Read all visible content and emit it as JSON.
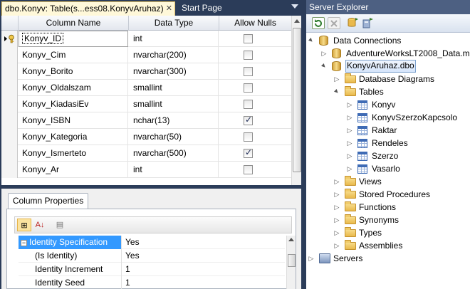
{
  "tabs": [
    {
      "label": "dbo.Konyv: Table(s...ess08.KonyvAruhaz)",
      "close": "✕"
    },
    {
      "label": "Start Page"
    }
  ],
  "grid": {
    "headers": [
      "Column Name",
      "Data Type",
      "Allow Nulls"
    ],
    "rows": [
      {
        "name": "Konyv_ID",
        "type": "int",
        "null": false,
        "key": true
      },
      {
        "name": "Konyv_Cim",
        "type": "nvarchar(200)",
        "null": false
      },
      {
        "name": "Konyv_Borito",
        "type": "nvarchar(300)",
        "null": false
      },
      {
        "name": "Konyv_Oldalszam",
        "type": "smallint",
        "null": false
      },
      {
        "name": "Konyv_KiadasiEv",
        "type": "smallint",
        "null": false
      },
      {
        "name": "Konyv_ISBN",
        "type": "nchar(13)",
        "null": true
      },
      {
        "name": "Konyv_Kategoria",
        "type": "nvarchar(50)",
        "null": false
      },
      {
        "name": "Konyv_Ismerteto",
        "type": "nvarchar(500)",
        "null": true
      },
      {
        "name": "Konyv_Ar",
        "type": "int",
        "null": false
      }
    ]
  },
  "column_properties": {
    "tab_label": "Column Properties",
    "toolbar": {
      "categorized": "⊞",
      "alphabetical": "A↓",
      "pages": "▤"
    },
    "collapse_glyph": "−",
    "rows": [
      {
        "name": "Identity Specification",
        "value": "Yes"
      },
      {
        "name": "(Is Identity)",
        "value": "Yes"
      },
      {
        "name": "Identity Increment",
        "value": "1"
      },
      {
        "name": "Identity Seed",
        "value": "1"
      }
    ]
  },
  "server_explorer": {
    "title": "Server Explorer",
    "tree": [
      {
        "label": "Data Connections",
        "level": 0,
        "arrow": "▲",
        "icon": "db-icon"
      },
      {
        "label": "AdventureWorksLT2008_Data.m",
        "level": 1,
        "arrow": "▷",
        "icon": "db-icon"
      },
      {
        "label": "KonyvAruhaz.dbo",
        "level": 1,
        "arrow": "▲",
        "icon": "db-icon",
        "selected": true
      },
      {
        "label": "Database Diagrams",
        "level": 2,
        "arrow": "▷",
        "icon": "folder-icon"
      },
      {
        "label": "Tables",
        "level": 2,
        "arrow": "▲",
        "icon": "folder-icon"
      },
      {
        "label": "Konyv",
        "level": 3,
        "arrow": "▷",
        "icon": "table-icon"
      },
      {
        "label": "KonyvSzerzoKapcsolo",
        "level": 3,
        "arrow": "▷",
        "icon": "table-icon"
      },
      {
        "label": "Raktar",
        "level": 3,
        "arrow": "▷",
        "icon": "table-icon"
      },
      {
        "label": "Rendeles",
        "level": 3,
        "arrow": "▷",
        "icon": "table-icon"
      },
      {
        "label": "Szerzo",
        "level": 3,
        "arrow": "▷",
        "icon": "table-icon"
      },
      {
        "label": "Vasarlo",
        "level": 3,
        "arrow": "▷",
        "icon": "table-icon"
      },
      {
        "label": "Views",
        "level": 2,
        "arrow": "▷",
        "icon": "folder-icon"
      },
      {
        "label": "Stored Procedures",
        "level": 2,
        "arrow": "▷",
        "icon": "folder-icon"
      },
      {
        "label": "Functions",
        "level": 2,
        "arrow": "▷",
        "icon": "folder-icon"
      },
      {
        "label": "Synonyms",
        "level": 2,
        "arrow": "▷",
        "icon": "folder-icon"
      },
      {
        "label": "Types",
        "level": 2,
        "arrow": "▷",
        "icon": "folder-icon"
      },
      {
        "label": "Assemblies",
        "level": 2,
        "arrow": "▷",
        "icon": "folder-icon"
      },
      {
        "label": "Servers",
        "level": 0,
        "arrow": "▷",
        "icon": "server-icon"
      }
    ]
  },
  "colors": {
    "frame": "#2b3c59",
    "active_tab": "#fff8d9",
    "selection": "#3399ff",
    "se_title": "#4d6082"
  }
}
